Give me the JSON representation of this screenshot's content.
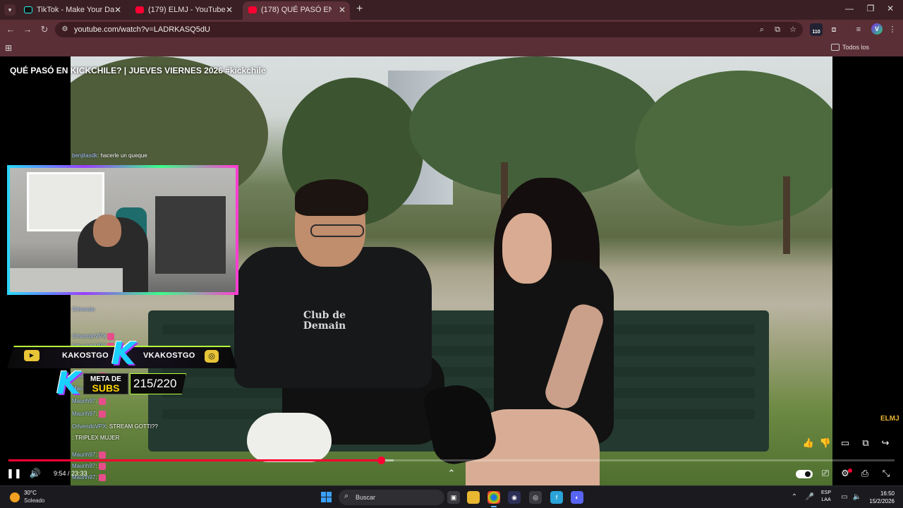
{
  "browser": {
    "tabs": [
      {
        "label": "TikTok - Make Your Day",
        "favicon": "tiktok-icon",
        "active": false
      },
      {
        "label": "(179) ELMJ - YouTube",
        "favicon": "youtube-icon",
        "active": false
      },
      {
        "label": "(178) QUÉ PASÓ EN KICKCHILE",
        "favicon": "youtube-icon",
        "active": true
      }
    ],
    "new_tab": "+",
    "url": "youtube.com/watch?v=LADRKASQ5dU",
    "extension_badge": "110",
    "profile_initial": "V",
    "bookmarks_label": "Todos los marcadores",
    "accent_color": "#5a2f35"
  },
  "video": {
    "title": "QUÉ PASÓ EN KICKCHILE? | JUEVES VIERNES 2026  #kickchile",
    "shirt_print": "Club de Demain",
    "current_time": "9:54",
    "duration": "23:33",
    "time_display": "9:54 / 23:33",
    "played_fraction": 0.42,
    "loaded_fraction": 0.435,
    "watermark": "ELMJ"
  },
  "stream_overlay": {
    "youtube_name": "KAKOSTGO",
    "kick_name": "VKAKOSTGO",
    "logo_letter": "K",
    "goal_label_top": "META DE",
    "goal_label_bottom": "SUBS",
    "goal_count": "215/220"
  },
  "chat": [
    {
      "user": "benjitasdk",
      "msg": ": hacerle un queque",
      "emote": false
    },
    {
      "user": "Orlvendo",
      "msg": "",
      "emote": false
    },
    {
      "user": "OrlvendoVPX",
      "msg": "",
      "emote": true
    },
    {
      "user": "OrlvendoVPX",
      "msg": "",
      "emote": true
    },
    {
      "user": "Maurih97",
      "msg": ":",
      "emote": true
    },
    {
      "user": "Maurih97",
      "msg": ":",
      "emote": true
    },
    {
      "user": "Maurih97",
      "msg": ":",
      "emote": true
    },
    {
      "user": "Maurih97",
      "msg": ":",
      "emote": true
    },
    {
      "user": "Maurih97",
      "msg": ":",
      "emote": true
    },
    {
      "user": "OrlvendoVPX",
      "msg": ": STREAM GOTTI??",
      "emote": false
    },
    {
      "user": "",
      "msg": ": TRIPLEX MUJER",
      "emote": false
    },
    {
      "user": "Maurih97",
      "msg": ":",
      "emote": true
    },
    {
      "user": "Maurih97",
      "msg": ":",
      "emote": true
    },
    {
      "user": "Maurih97",
      "msg": ":",
      "emote": true
    },
    {
      "user": "Maurih97",
      "msg": ":",
      "emote": true
    },
    {
      "user": "Maurih97",
      "msg": ":",
      "emote": true
    }
  ],
  "taskbar": {
    "weather_temp": "30°C",
    "weather_desc": "Soleado",
    "search_placeholder": "Buscar",
    "lang_top": "ESP",
    "lang_bottom": "LAA",
    "time": "16:50",
    "date": "15/2/2026"
  }
}
